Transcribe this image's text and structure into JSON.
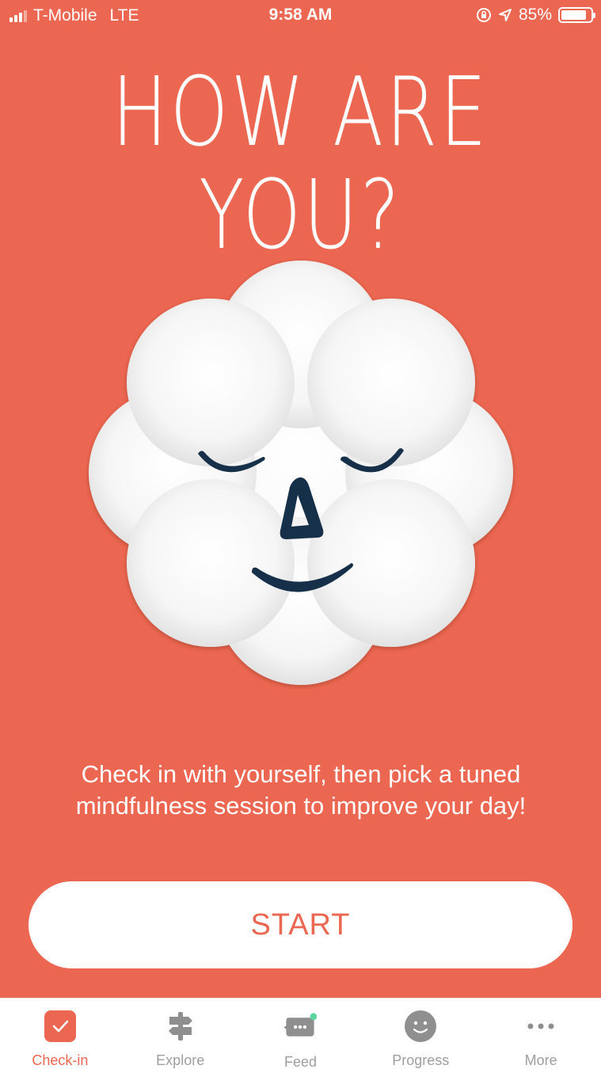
{
  "status_bar": {
    "carrier": "T-Mobile",
    "network": "LTE",
    "time": "9:58 AM",
    "battery": "85%",
    "battery_level": 0.85
  },
  "title": "HOW ARE YOU?",
  "description": "Check in with yourself, then pick a tuned mindfulness session to improve your day!",
  "start_label": "START",
  "tabs": [
    {
      "label": "Check-in",
      "icon": "checkmark-icon",
      "active": true
    },
    {
      "label": "Explore",
      "icon": "signpost-icon",
      "active": false
    },
    {
      "label": "Feed",
      "icon": "chat-bubble-icon",
      "active": false,
      "badge": true
    },
    {
      "label": "Progress",
      "icon": "smiley-icon",
      "active": false
    },
    {
      "label": "More",
      "icon": "more-dots-icon",
      "active": false
    }
  ],
  "colors": {
    "background": "#ec6752",
    "face_features": "#17304a",
    "tab_inactive": "#9e9e9e",
    "badge": "#5dd39e"
  }
}
